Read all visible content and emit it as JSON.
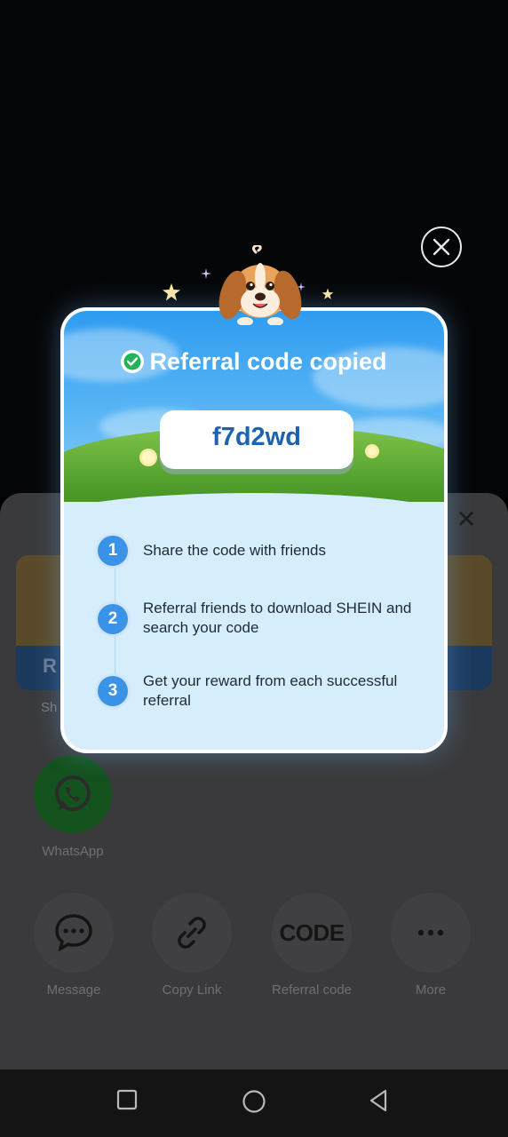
{
  "background": {
    "share_sheet": {
      "banner_text": "R",
      "share_label": "Sh",
      "apps": [
        {
          "label": "WhatsApp",
          "icon": "whatsapp-icon"
        }
      ],
      "actions": [
        {
          "label": "Message",
          "icon": "message-icon"
        },
        {
          "label": "Copy Link",
          "icon": "link-icon"
        },
        {
          "label": "Referral code",
          "icon_text": "CODE"
        },
        {
          "label": "More",
          "icon": "more-icon"
        }
      ]
    }
  },
  "modal": {
    "title": "Referral code copied",
    "code": "f7d2wd",
    "steps": [
      {
        "number": "1",
        "text": "Share the code with friends"
      },
      {
        "number": "2",
        "text": "Referral friends to download SHEIN and search your code"
      },
      {
        "number": "3",
        "text": "Get your reward from each successful referral"
      }
    ]
  },
  "colors": {
    "accent_blue": "#3a93e6",
    "code_text": "#1c63b0",
    "modal_background": "#d6edfb"
  }
}
